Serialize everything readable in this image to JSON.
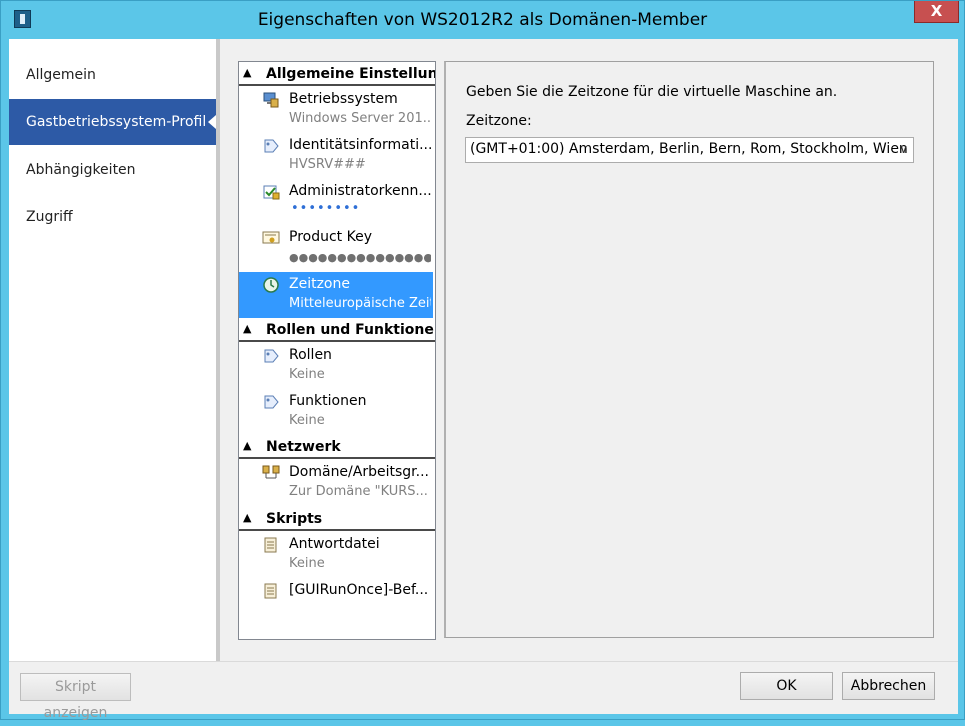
{
  "window": {
    "title": "Eigenschaften von WS2012R2 als Domänen-Member",
    "close_glyph": "X"
  },
  "nav": {
    "items": [
      {
        "label": "Allgemein",
        "selected": false
      },
      {
        "label": "Gastbetriebssystem-Profil",
        "selected": true
      },
      {
        "label": "Abhängigkeiten",
        "selected": false
      },
      {
        "label": "Zugriff",
        "selected": false
      }
    ]
  },
  "settings_list": {
    "groups": [
      {
        "title": "Allgemeine Einstellunge"
      },
      {
        "title": "Rollen und Funktionen"
      },
      {
        "title": "Netzwerk"
      },
      {
        "title": "Skripts"
      }
    ],
    "items": [
      {
        "title": "Betriebssystem",
        "subtitle": "Windows Server 201...",
        "icon": "computer-icon"
      },
      {
        "title": "Identitätsinformati...",
        "subtitle": "HVSRV###",
        "icon": "id-tag-icon"
      },
      {
        "title": "Administratorkenn...",
        "subtitle": "••••••••",
        "icon": "admin-password-icon"
      },
      {
        "title": "Product Key",
        "subtitle": "●●●●●●●●●●●●●●●...",
        "icon": "certificate-icon"
      },
      {
        "title": "Zeitzone",
        "subtitle": "Mitteleuropäische Zeit",
        "icon": "clock-icon",
        "selected": true
      },
      {
        "title": "Rollen",
        "subtitle": "Keine",
        "icon": "role-tag-icon"
      },
      {
        "title": "Funktionen",
        "subtitle": "Keine",
        "icon": "feature-tag-icon"
      },
      {
        "title": "Domäne/Arbeitsgr...",
        "subtitle": "Zur Domäne \"KURS...",
        "icon": "network-computers-icon"
      },
      {
        "title": "Antwortdatei",
        "subtitle": "Keine",
        "icon": "script-icon"
      },
      {
        "title": "[GUIRunOnce]-Bef...",
        "subtitle": "",
        "icon": "script-icon"
      }
    ]
  },
  "detail": {
    "description": "Geben Sie die Zeitzone für die virtuelle Maschine an.",
    "label": "Zeitzone:",
    "timezone_value": "(GMT+01:00) Amsterdam, Berlin, Bern, Rom, Stockholm, Wien"
  },
  "buttons": {
    "show_script": "Skript anzeigen",
    "ok": "OK",
    "cancel": "Abbrechen"
  },
  "colors": {
    "selection_blue": "#3399ff",
    "nav_selected": "#2d5aa6",
    "frame": "#5bc6e8"
  }
}
